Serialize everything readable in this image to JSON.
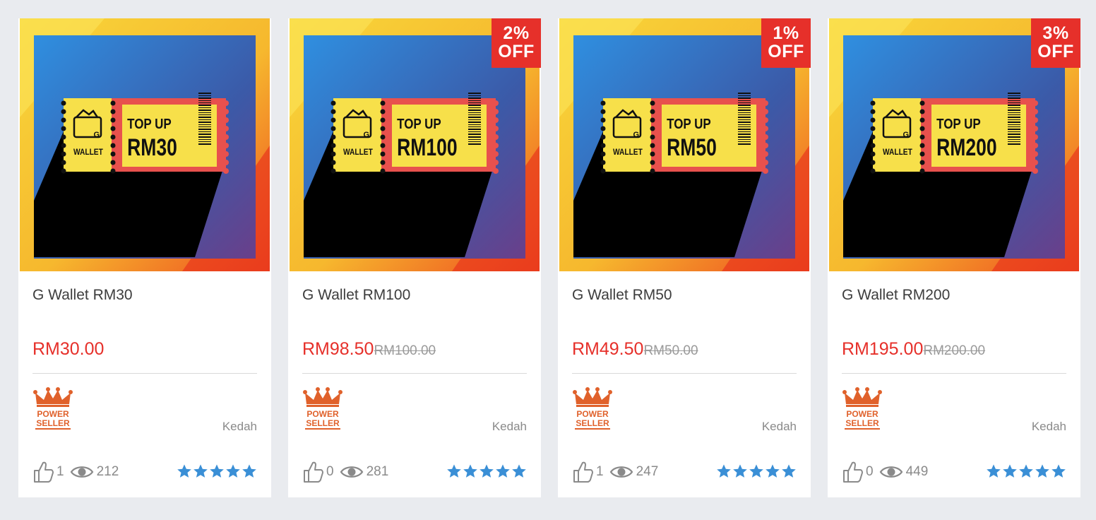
{
  "products": [
    {
      "image_top": "TOP UP",
      "image_amount": "RM30",
      "image_wallet": "WALLET",
      "image_g": "G",
      "badge_line1": "",
      "badge_line2": "",
      "has_badge": false,
      "title": "G Wallet RM30",
      "price": "RM30.00",
      "old_price": "",
      "seller_line1": "POWER",
      "seller_line2": "SELLER",
      "location": "Kedah",
      "likes": "1",
      "views": "212",
      "rating": 5
    },
    {
      "image_top": "TOP UP",
      "image_amount": "RM100",
      "image_wallet": "WALLET",
      "image_g": "G",
      "badge_line1": "2%",
      "badge_line2": "OFF",
      "has_badge": true,
      "title": "G Wallet RM100",
      "price": "RM98.50",
      "old_price": "RM100.00",
      "seller_line1": "POWER",
      "seller_line2": "SELLER",
      "location": "Kedah",
      "likes": "0",
      "views": "281",
      "rating": 5
    },
    {
      "image_top": "TOP UP",
      "image_amount": "RM50",
      "image_wallet": "WALLET",
      "image_g": "G",
      "badge_line1": "1%",
      "badge_line2": "OFF",
      "has_badge": true,
      "title": "G Wallet RM50",
      "price": "RM49.50",
      "old_price": "RM50.00",
      "seller_line1": "POWER",
      "seller_line2": "SELLER",
      "location": "Kedah",
      "likes": "1",
      "views": "247",
      "rating": 5
    },
    {
      "image_top": "TOP UP",
      "image_amount": "RM200",
      "image_wallet": "WALLET",
      "image_g": "G",
      "badge_line1": "3%",
      "badge_line2": "OFF",
      "has_badge": true,
      "title": "G Wallet RM200",
      "price": "RM195.00",
      "old_price": "RM200.00",
      "seller_line1": "POWER",
      "seller_line2": "SELLER",
      "location": "Kedah",
      "likes": "0",
      "views": "449",
      "rating": 5
    }
  ],
  "colors": {
    "background": "#e9ebef",
    "price_red": "#e6302a",
    "badge_red": "#e6302a",
    "star_blue": "#3a8fd6",
    "seller_orange": "#e0612b",
    "ticket_yellow": "#f7e04a",
    "ticket_red": "#e8514d"
  },
  "icons": {
    "like": "thumbs-up-icon",
    "views": "eye-icon",
    "rating": "star-icon",
    "seller": "crown-icon"
  }
}
